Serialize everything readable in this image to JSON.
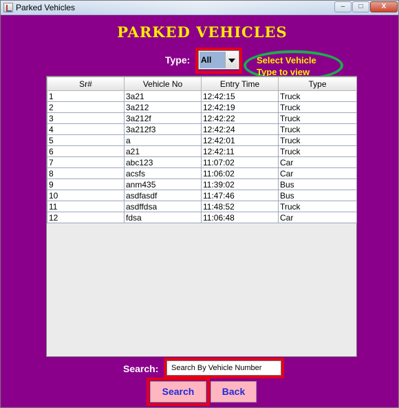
{
  "window": {
    "title": "Parked Vehicles",
    "controls": {
      "minimize": "–",
      "maximize": "□",
      "close": "X"
    }
  },
  "heading": "PARKED VEHICLES",
  "filter": {
    "label": "Type:",
    "selected": "All",
    "hint_line1": "Select Vehicle",
    "hint_line2": "Type to view"
  },
  "table": {
    "columns": [
      "Sr#",
      "Vehicle No",
      "Entry Time",
      "Type"
    ],
    "rows": [
      [
        "1",
        "3a21",
        "12:42:15",
        "Truck"
      ],
      [
        "2",
        "3a212",
        "12:42:19",
        "Truck"
      ],
      [
        "3",
        "3a212f",
        "12:42:22",
        "Truck"
      ],
      [
        "4",
        "3a212f3",
        "12:42:24",
        "Truck"
      ],
      [
        "5",
        "a",
        "12:42:01",
        "Truck"
      ],
      [
        "6",
        "a21",
        "12:42:11",
        "Truck"
      ],
      [
        "7",
        "abc123",
        "11:07:02",
        "Car"
      ],
      [
        "8",
        "acsfs",
        "11:06:02",
        "Car"
      ],
      [
        "9",
        "anm435",
        "11:39:02",
        "Bus"
      ],
      [
        "10",
        "asdfasdf",
        "11:47:46",
        "Bus"
      ],
      [
        "11",
        "asdffdsa",
        "11:48:52",
        "Truck"
      ],
      [
        "12",
        "fdsa",
        "11:06:48",
        "Car"
      ]
    ]
  },
  "search": {
    "label": "Search:",
    "value": "Search By Vehicle Number",
    "search_button": "Search",
    "back_button": "Back"
  },
  "colors": {
    "background": "#8b008b",
    "heading": "#ffeb00",
    "highlight": "#e3001b",
    "hint_ellipse": "#1bae4b",
    "button_bg": "#ffb6c1",
    "button_text": "#1f2bd6"
  }
}
